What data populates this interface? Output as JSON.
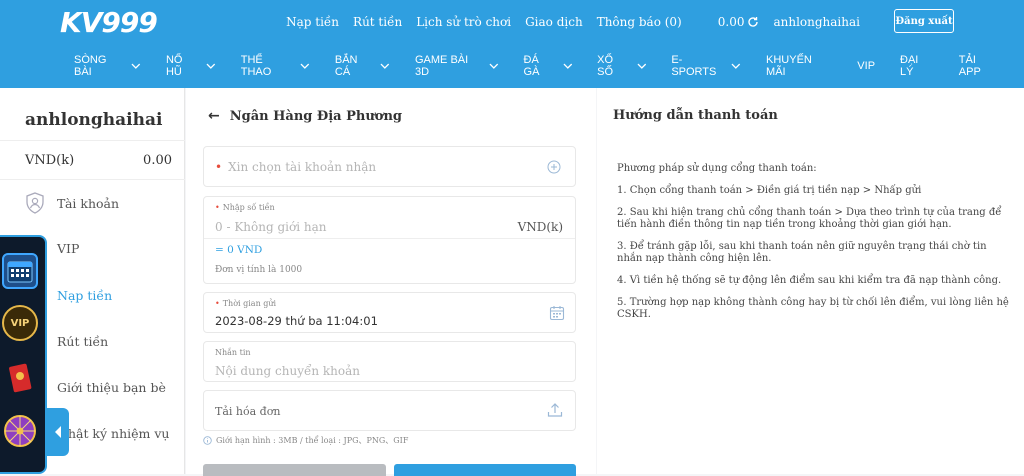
{
  "header": {
    "logo_text": "KV999",
    "links": [
      "Nạp tiền",
      "Rút tiền",
      "Lịch sử trò chơi",
      "Giao dịch",
      "Thông báo (0)"
    ],
    "balance": "0.00",
    "username": "anhlonghaihai",
    "logout_label": "Đăng xuất"
  },
  "nav": {
    "items": [
      {
        "label": "SÒNG BÀI",
        "dropdown": true
      },
      {
        "label": "NỔ HŨ",
        "dropdown": true
      },
      {
        "label": "THỂ THAO",
        "dropdown": true
      },
      {
        "label": "BẮN CÁ",
        "dropdown": true
      },
      {
        "label": "GAME BÀI 3D",
        "dropdown": true
      },
      {
        "label": "ĐÁ GÀ",
        "dropdown": true
      },
      {
        "label": "XỔ SỐ",
        "dropdown": true
      },
      {
        "label": "E-SPORTS",
        "dropdown": true
      },
      {
        "label": "KHUYẾN MÃI",
        "dropdown": false
      },
      {
        "label": "VIP",
        "dropdown": false
      },
      {
        "label": "ĐẠI LÝ",
        "dropdown": false
      },
      {
        "label": "TẢI APP",
        "dropdown": false
      }
    ]
  },
  "sidebar": {
    "username": "anhlonghaihai",
    "currency": "VND(k)",
    "balance": "0.00",
    "items": [
      "Tài khoản",
      "VIP",
      "Nạp tiền",
      "Rút tiền",
      "Giới thiệu bạn bè",
      "Nhật ký nhiệm vụ"
    ],
    "active": "Nạp tiền"
  },
  "form": {
    "title": "Ngân Hàng Địa Phương",
    "account_placeholder": "Xin chọn tài khoản nhận",
    "amount_label": "Nhập số tiền",
    "amount_placeholder": "0 - Không giới hạn",
    "amount_unit": "VND(k)",
    "converted": "= 0 VND",
    "unit_note": "Đơn vị tính là 1000",
    "time_label": "Thời gian gửi",
    "time_value": "2023-08-29 thứ ba 11:04:01",
    "note_label": "Nhắn tin",
    "note_placeholder": "Nội dung chuyển khoản",
    "upload_label": "Tải hóa đơn",
    "upload_hint": "Giới hạn hình : 3MB / thể loại : JPG、PNG、GIF"
  },
  "guide": {
    "title": "Hướng dẫn thanh toán",
    "intro": "Phương pháp sử dụng cổng thanh toán:",
    "steps": [
      "1. Chọn cổng thanh toán > Điền giá trị tiền nạp > Nhấp gửi",
      "2. Sau khi hiện trang chủ cổng thanh toán > Dựa theo trình tự của trang để tiến hành điền thông tin nạp tiền trong khoảng thời gian giới hạn.",
      "3. Để tránh gặp lỗi, sau khi thanh toán nên giữ nguyên trạng thái chờ tin nhắn nạp thành công hiện lên.",
      "4. Vì tiền hệ thống sẽ tự động lên điểm sau khi kiểm tra đã nạp thành công.",
      "5. Trường hợp nạp không thành công hay bị từ chối lên điểm, vui lòng liên hệ CSKH."
    ]
  },
  "colors": {
    "brand": "#2f9fe0",
    "required": "#e74c3c",
    "floating_panel": "#0d1a2b"
  }
}
